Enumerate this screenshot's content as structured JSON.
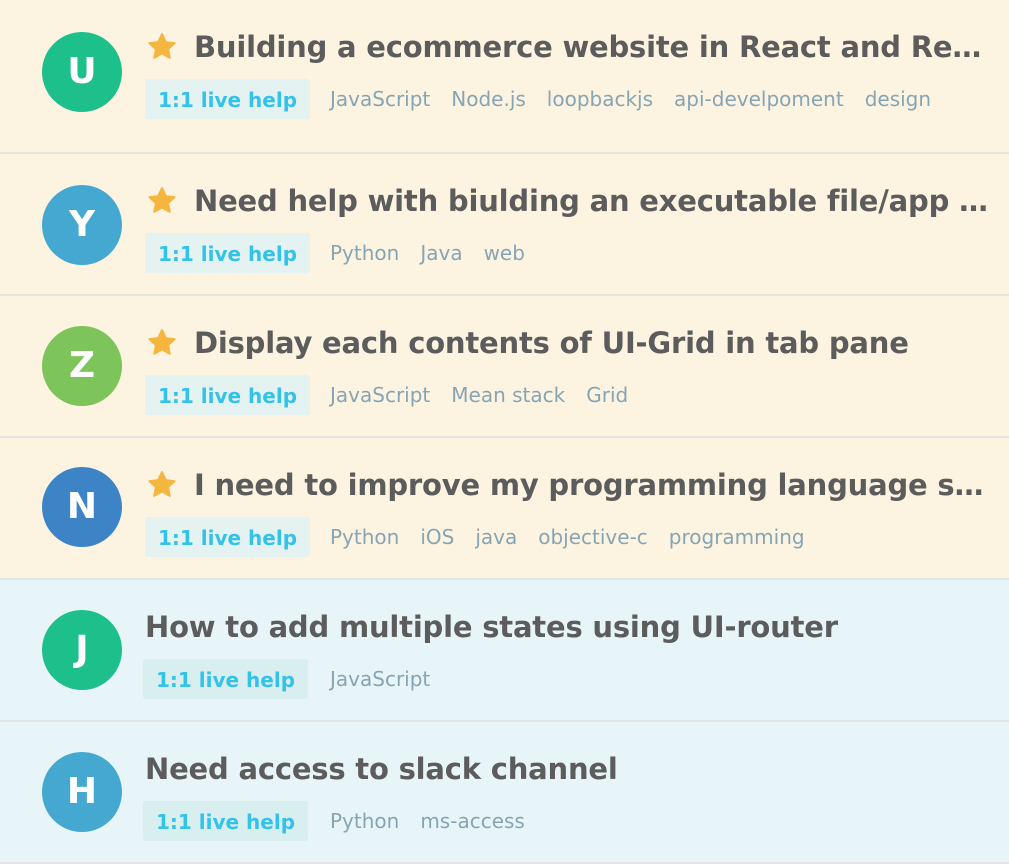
{
  "badge_label": "1:1 live help",
  "colors": {
    "featured_bg": "#fcf3e1",
    "regular_bg": "#e7f4f8",
    "badge_text": "#33c2e8",
    "tag_text": "#86a5b4",
    "title_text": "#5c5c5c",
    "star": "#f4b63f"
  },
  "requests": [
    {
      "initial": "U",
      "avatar_color": "#1dbf8b",
      "featured": true,
      "title": "Building a ecommerce website in React and Redux with Loopback",
      "tags": [
        "JavaScript",
        "Node.js",
        "loopbackjs",
        "api-develpoment",
        "design"
      ]
    },
    {
      "initial": "Y",
      "avatar_color": "#45a8d1",
      "featured": true,
      "title": "Need help with biulding an executable file/app for my program",
      "tags": [
        "Python",
        "Java",
        "web"
      ]
    },
    {
      "initial": "Z",
      "avatar_color": "#7dc45a",
      "featured": true,
      "title": "Display each contents of UI-Grid in tab pane",
      "tags": [
        "JavaScript",
        "Mean stack",
        "Grid"
      ]
    },
    {
      "initial": "N",
      "avatar_color": "#3d84c6",
      "featured": true,
      "title": "I need to improve my programming language skills",
      "tags": [
        "Python",
        "iOS",
        "java",
        "objective-c",
        "programming"
      ]
    },
    {
      "initial": "J",
      "avatar_color": "#1dbf8b",
      "featured": false,
      "title": "How to add multiple states using UI-router",
      "tags": [
        "JavaScript"
      ]
    },
    {
      "initial": "H",
      "avatar_color": "#45a8d1",
      "featured": false,
      "title": "Need access to slack channel",
      "tags": [
        "Python",
        "ms-access"
      ]
    }
  ]
}
